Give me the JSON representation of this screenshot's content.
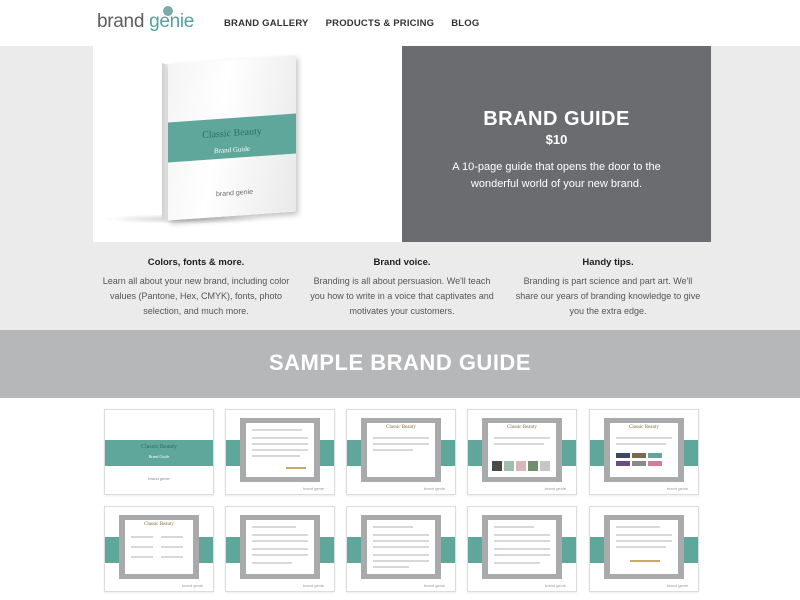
{
  "header": {
    "logo_brand": "brand ",
    "logo_genie": "genie",
    "nav": [
      "BRAND GALLERY",
      "PRODUCTS & PRICING",
      "BLOG"
    ]
  },
  "hero": {
    "title": "BRAND GUIDE",
    "price": "$10",
    "description": "A 10-page guide that opens the door to the wonderful world of your new brand.",
    "book_title": "Classic Beauty",
    "book_subtitle": "Brand Guide",
    "book_logo": "brand genie"
  },
  "features": [
    {
      "title": "Colors, fonts & more.",
      "text": "Learn all about your new brand, including color values (Pantone, Hex, CMYK), fonts, photo selection, and much more."
    },
    {
      "title": "Brand voice.",
      "text": "Branding is all about persuasion. We'll teach you how to write in a voice that captivates and motivates your customers."
    },
    {
      "title": "Handy tips.",
      "text": "Branding is part science and part art. We'll share our years of branding knowledge to give you the extra edge."
    }
  ],
  "banner": {
    "title": "SAMPLE BRAND GUIDE"
  },
  "thumbnails": {
    "cover_title": "Classic Beauty",
    "cover_subtitle": "Brand Guide",
    "logo": "brand genie",
    "page_header": "Classic Beauty"
  },
  "colors": {
    "accent_teal": "#5fa79a",
    "hero_panel": "#6b6c70",
    "banner": "#b6b7b9",
    "logo_teal": "#4fa3a0"
  }
}
